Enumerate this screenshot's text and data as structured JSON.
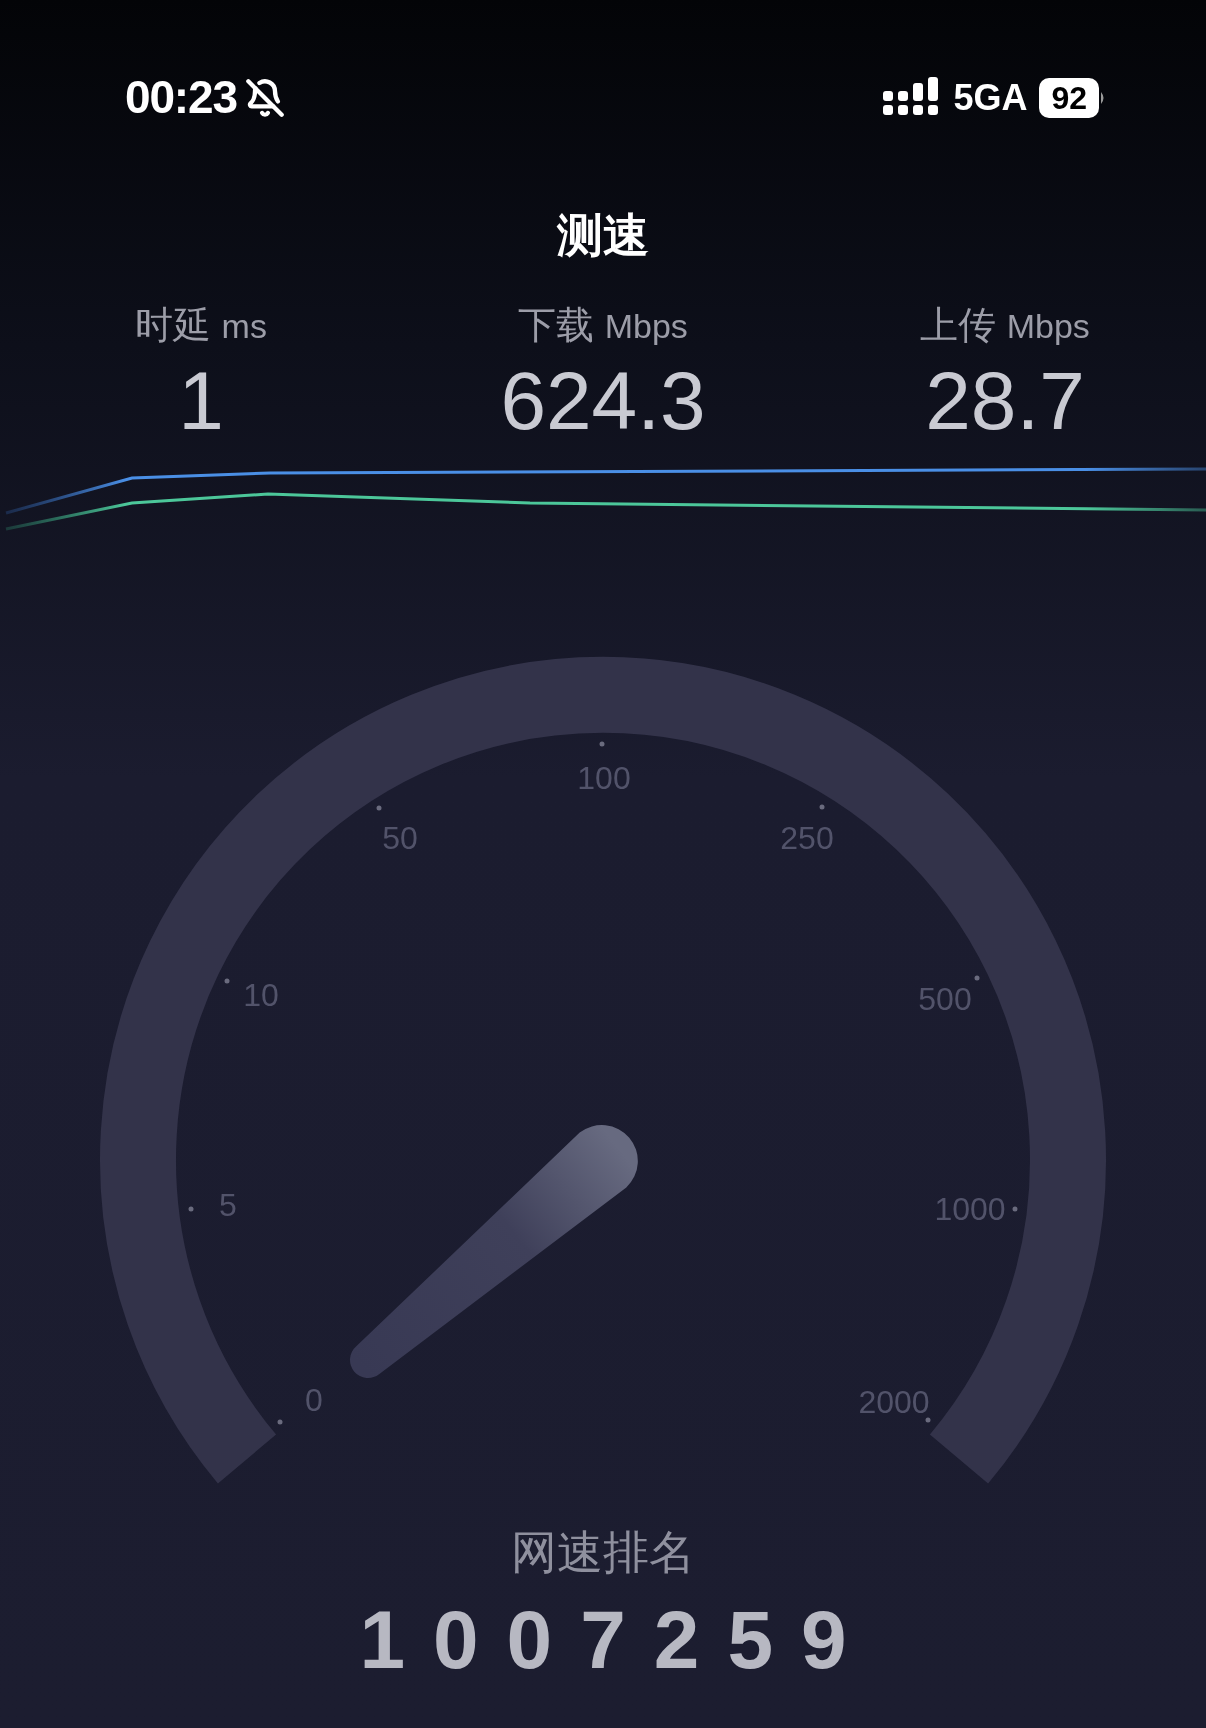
{
  "status_bar": {
    "time": "00:23",
    "network": "5GA",
    "battery": "92"
  },
  "title": "测速",
  "metrics": [
    {
      "label": "时延",
      "unit": "ms",
      "value": "1"
    },
    {
      "label": "下载",
      "unit": "Mbps",
      "value": "624.3"
    },
    {
      "label": "上传",
      "unit": "Mbps",
      "value": "28.7"
    }
  ],
  "gauge": {
    "ticks": [
      "0",
      "5",
      "10",
      "50",
      "100",
      "250",
      "500",
      "1000",
      "2000"
    ]
  },
  "ranking": {
    "label": "网速排名",
    "value": "1007259"
  }
}
